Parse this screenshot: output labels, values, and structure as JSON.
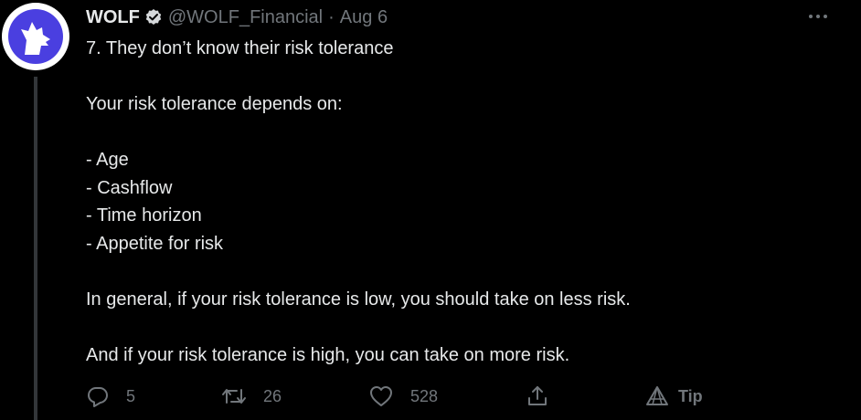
{
  "tweet": {
    "author_name": "WOLF",
    "handle": "@WOLF_Financial",
    "separator": "·",
    "date": "Aug 6",
    "body_lines": [
      "7. They don’t know their risk tolerance",
      "",
      "Your risk tolerance depends on:",
      "",
      "- Age",
      "- Cashflow",
      "- Time horizon",
      "- Appetite for risk",
      "",
      "In general, if your risk tolerance is low, you should take on less risk.",
      "",
      "And if your risk tolerance is high, you can take on more risk."
    ],
    "actions": {
      "reply_count": "5",
      "retweet_count": "26",
      "like_count": "528",
      "tip_label": "Tip"
    }
  },
  "icons": {
    "verified": "verified-badge-icon",
    "more": "more-options-icon",
    "reply": "reply-icon",
    "retweet": "retweet-icon",
    "like": "heart-icon",
    "share": "share-icon",
    "tip": "tip-icon",
    "avatar": "wolf-logo-avatar"
  },
  "colors": {
    "background": "#000000",
    "text_primary": "#e7e9ea",
    "text_secondary": "#71767b",
    "thread_line": "#333639",
    "avatar_brand": "#4a3fe0"
  }
}
